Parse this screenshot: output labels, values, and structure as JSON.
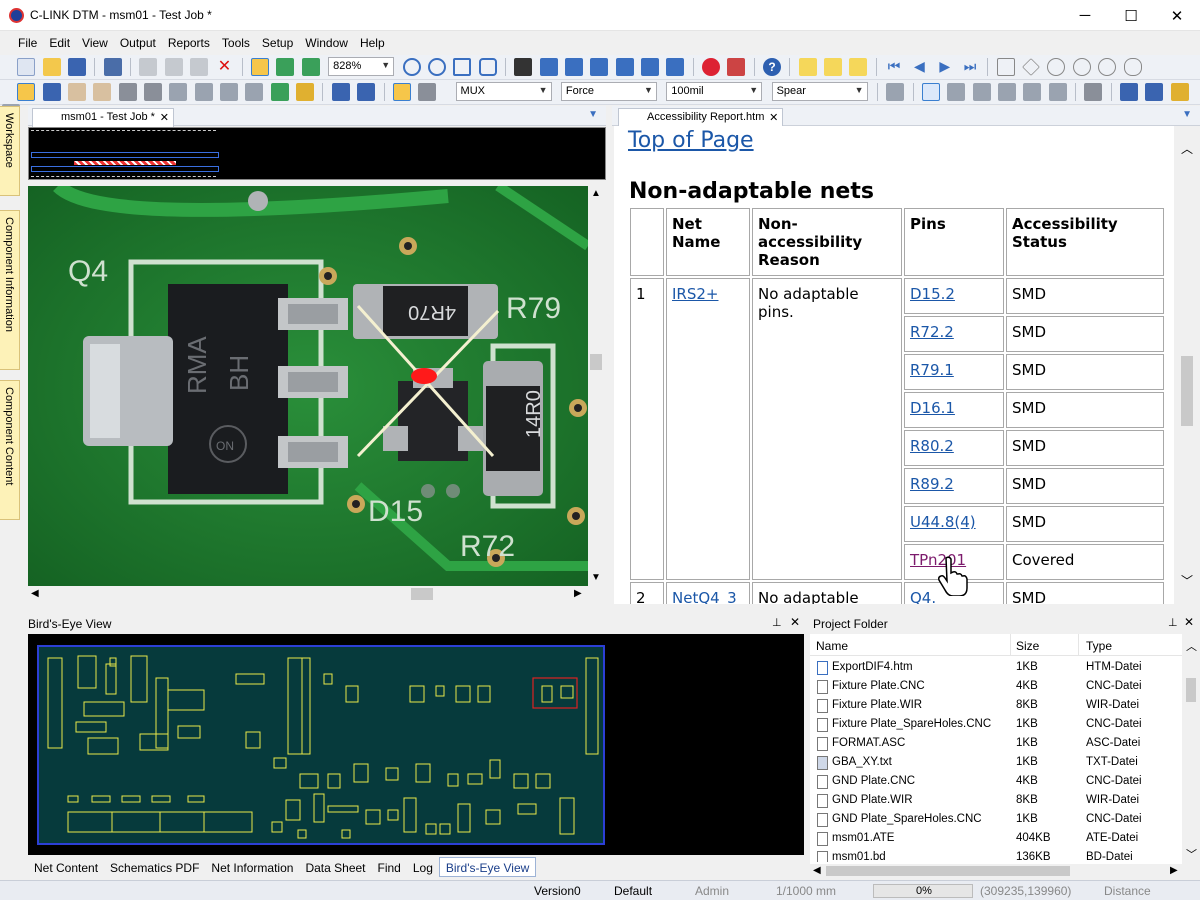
{
  "window": {
    "title": "C-LINK DTM - msm01 - Test Job *",
    "minimize": "─",
    "maximize": "☐",
    "close": "✕"
  },
  "menu": [
    "File",
    "Edit",
    "View",
    "Output",
    "Reports",
    "Tools",
    "Setup",
    "Window",
    "Help"
  ],
  "toolbar1": {
    "zoom": "828%"
  },
  "toolbar2": {
    "combo1": "MUX",
    "combo2": "Force",
    "combo3": "100mil",
    "combo4": "Spear"
  },
  "sidetabs": [
    "Workspace",
    "Component Information",
    "Component Content"
  ],
  "left_doc": {
    "tab": "msm01 - Test Job *"
  },
  "pcb_labels": {
    "q4": "Q4",
    "r79": "R79",
    "d15": "D15",
    "r72": "R72",
    "part1": "4R70",
    "part2": "14R0",
    "part3": "RMA",
    "part4": "BH",
    "logo": "ON"
  },
  "right_doc": {
    "tab": "Accessibility Report.htm"
  },
  "report": {
    "top_link": "Top of Page",
    "heading": "Non-adaptable nets",
    "headers": {
      "net": "Net Name",
      "reason": "Non-accessibility Reason",
      "pins": "Pins",
      "status": "Accessibility Status"
    },
    "row1": {
      "num": "1",
      "net": "IRS2+",
      "reason": "No adaptable pins."
    },
    "pins": [
      {
        "pin": "D15.2",
        "status": "SMD"
      },
      {
        "pin": "R72.2",
        "status": "SMD"
      },
      {
        "pin": "R79.1",
        "status": "SMD"
      },
      {
        "pin": "D16.1",
        "status": "SMD"
      },
      {
        "pin": "R80.2",
        "status": "SMD"
      },
      {
        "pin": "R89.2",
        "status": "SMD"
      },
      {
        "pin": "U44.8(4)",
        "status": "SMD"
      },
      {
        "pin": "TPn201",
        "status": "Covered"
      }
    ],
    "row2": {
      "num": "2",
      "net": "NetQ4_3",
      "reason": "No adaptable",
      "pin": "Q4.",
      "status": "SMD"
    }
  },
  "birdseye": {
    "title": "Bird's-Eye View"
  },
  "project_folder": {
    "title": "Project Folder",
    "columns": [
      "Name",
      "Size",
      "Type"
    ],
    "files": [
      {
        "name": "ExportDIF4.htm",
        "size": "1KB",
        "type": "HTM-Datei"
      },
      {
        "name": "Fixture Plate.CNC",
        "size": "4KB",
        "type": "CNC-Datei"
      },
      {
        "name": "Fixture Plate.WIR",
        "size": "8KB",
        "type": "WIR-Datei"
      },
      {
        "name": "Fixture Plate_SpareHoles.CNC",
        "size": "1KB",
        "type": "CNC-Datei"
      },
      {
        "name": "FORMAT.ASC",
        "size": "1KB",
        "type": "ASC-Datei"
      },
      {
        "name": "GBA_XY.txt",
        "size": "1KB",
        "type": "TXT-Datei"
      },
      {
        "name": "GND Plate.CNC",
        "size": "4KB",
        "type": "CNC-Datei"
      },
      {
        "name": "GND Plate.WIR",
        "size": "8KB",
        "type": "WIR-Datei"
      },
      {
        "name": "GND Plate_SpareHoles.CNC",
        "size": "1KB",
        "type": "CNC-Datei"
      },
      {
        "name": "msm01.ATE",
        "size": "404KB",
        "type": "ATE-Datei"
      },
      {
        "name": "msm01.bd",
        "size": "136KB",
        "type": "BD-Datei"
      }
    ]
  },
  "bottom_tabs": [
    "Net Content",
    "Schematics PDF",
    "Net Information",
    "Data Sheet",
    "Find",
    "Log",
    "Bird's-Eye View"
  ],
  "status": {
    "version": "Version0",
    "profile": "Default",
    "user": "Admin",
    "units": "1/1000 mm",
    "progress": "0%",
    "progress_value": 0,
    "coords": "(309235,139960)",
    "mode": "Distance"
  },
  "colors": {
    "pcb": "#1f7a2e",
    "accent": "#1b57a8",
    "visited": "#7c1a6c",
    "board": "#063a3c",
    "outline": "#e8e84a"
  }
}
